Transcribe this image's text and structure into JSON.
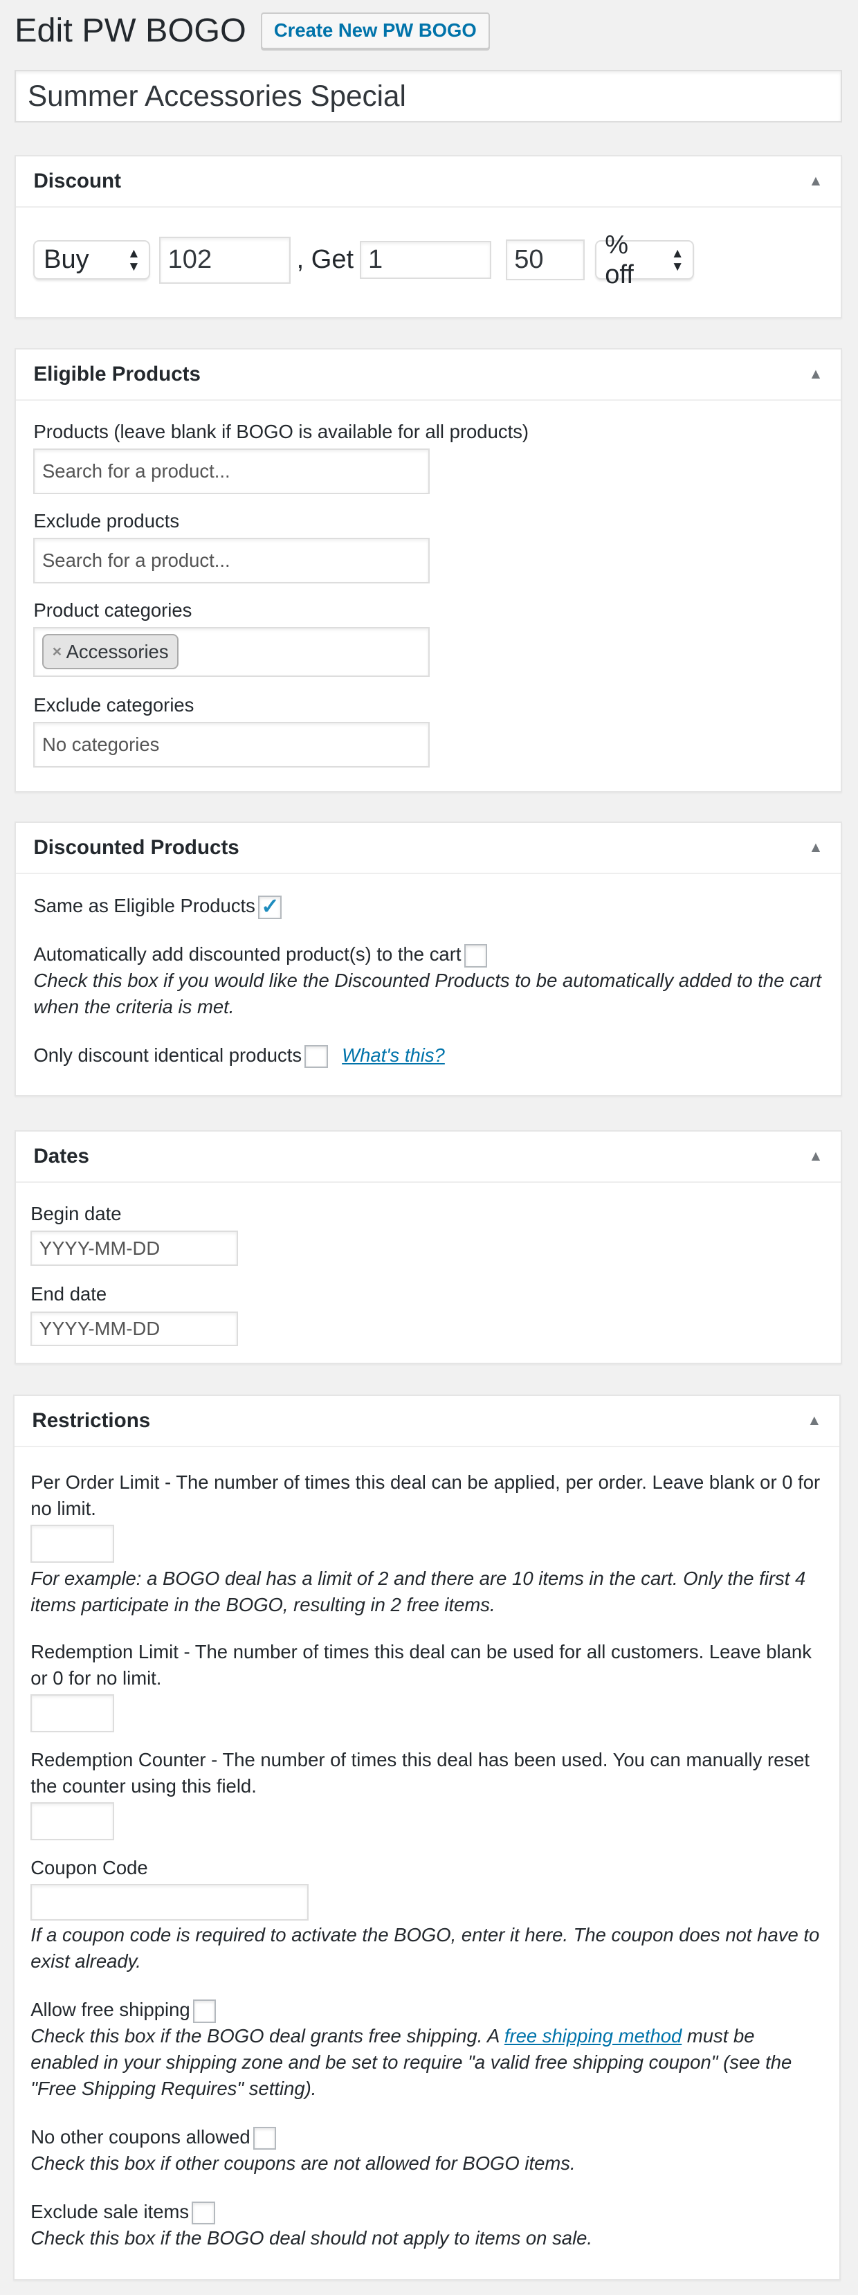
{
  "header": {
    "title": "Edit PW BOGO",
    "create_button": "Create New PW BOGO"
  },
  "title_input": {
    "value": "Summer Accessories Special"
  },
  "discount": {
    "title": "Discount",
    "type_select": "Buy",
    "buy_qty": "102",
    "get_label": ", Get",
    "get_qty": "1",
    "amount": "50",
    "amount_type_select": "% off"
  },
  "eligible": {
    "title": "Eligible Products",
    "products_label": "Products (leave blank if BOGO is available for all products)",
    "products_placeholder": "Search for a product...",
    "exclude_products_label": "Exclude products",
    "exclude_products_placeholder": "Search for a product...",
    "categories_label": "Product categories",
    "categories_selected": [
      "Accessories"
    ],
    "remove_symbol": "×",
    "exclude_categories_label": "Exclude categories",
    "exclude_categories_placeholder": "No categories"
  },
  "discounted": {
    "title": "Discounted Products",
    "same_as_label": "Same as Eligible Products",
    "same_as_checked": true,
    "auto_add_label": "Automatically add discounted product(s) to the cart",
    "auto_add_checked": false,
    "auto_add_desc": "Check this box if you would like the Discounted Products to be automatically added to the cart when the criteria is met.",
    "identical_label": "Only discount identical products",
    "identical_checked": false,
    "whats_this": "What's this?"
  },
  "dates": {
    "title": "Dates",
    "begin_label": "Begin date",
    "begin_placeholder": "YYYY-MM-DD",
    "end_label": "End date",
    "end_placeholder": "YYYY-MM-DD"
  },
  "restrictions": {
    "title": "Restrictions",
    "per_order_label": "Per Order Limit - The number of times this deal can be applied, per order. Leave blank or 0 for no limit.",
    "per_order_desc": "For example: a BOGO deal has a limit of 2 and there are 10 items in the cart. Only the first 4 items participate in the BOGO, resulting in 2 free items.",
    "redemption_limit_label": "Redemption Limit - The number of times this deal can be used for all customers. Leave blank or 0 for no limit.",
    "redemption_counter_label": "Redemption Counter - The number of times this deal has been used. You can manually reset the counter using this field.",
    "coupon_label": "Coupon Code",
    "coupon_desc": "If a coupon code is required to activate the BOGO, enter it here. The coupon does not have to exist already.",
    "free_shipping_label": "Allow free shipping",
    "free_shipping_desc_1": "Check this box if the BOGO deal grants free shipping. A ",
    "free_shipping_link": "free shipping method",
    "free_shipping_desc_2": " must be enabled in your shipping zone and be set to require \"a valid free shipping coupon\" (see the \"Free Shipping Requires\" setting).",
    "no_other_label": "No other coupons allowed",
    "no_other_desc": "Check this box if other coupons are not allowed for BOGO items.",
    "exclude_sale_label": "Exclude sale items",
    "exclude_sale_desc": "Check this box if the BOGO deal should not apply to items on sale."
  },
  "icons": {
    "collapse": "triangle-up-icon",
    "select_arrows": "up-down-arrows-icon",
    "checkmark": "checkmark-icon"
  },
  "colors": {
    "accent": "#0073aa",
    "check": "#1e8cbe",
    "background": "#f1f1f1"
  }
}
